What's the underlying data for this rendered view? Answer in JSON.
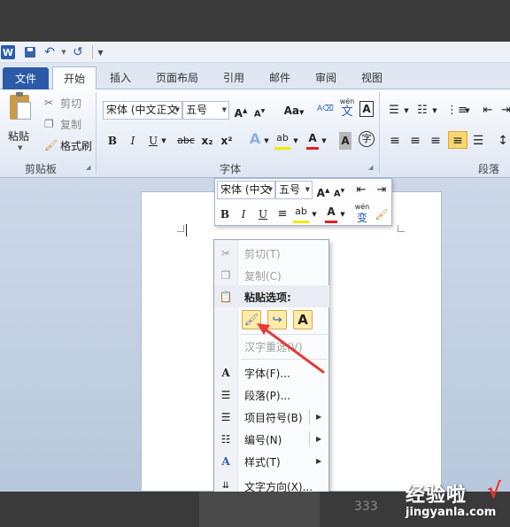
{
  "qat": {
    "logo": "W",
    "undo": "↶",
    "redo": "↺"
  },
  "tabs": [
    "文件",
    "开始",
    "插入",
    "页面布局",
    "引用",
    "邮件",
    "审阅",
    "视图"
  ],
  "clipboard": {
    "paste": "粘贴",
    "cut": "剪切",
    "copy": "复制",
    "format_painter": "格式刷",
    "group": "剪贴板"
  },
  "font": {
    "font_name": "宋体 (中文正文",
    "font_size": "五号",
    "change_case": "Aa",
    "pinyin": "wén",
    "pinyin_char": "文",
    "border_char": "A",
    "group": "字体",
    "format_buttons": [
      "B",
      "I",
      "U",
      "abc",
      "x₂",
      "x²"
    ],
    "text_effects": "A",
    "highlight": "ab",
    "font_color": "A",
    "char_shading": "A",
    "enclose": "字"
  },
  "paragraph": {
    "group": "段落"
  },
  "mini_toolbar": {
    "font_name": "宋体 (中文",
    "font_size": "五号",
    "pinyin": "wén",
    "pinyin_char": "变"
  },
  "context_menu": {
    "cut": "剪切(T)",
    "copy": "复制(C)",
    "paste_options": "粘贴选项:",
    "keep_text_only": "A",
    "hanzi_reconvert": "汉字重选(V)",
    "font": "字体(F)...",
    "paragraph": "段落(P)...",
    "bullets": "项目符号(B)",
    "numbering": "编号(N)",
    "styles": "样式(T)",
    "text_direction": "文字方向(X)..."
  },
  "watermark": {
    "site_cn": "经验啦",
    "check": "√",
    "site_url": "jingyanla.com",
    "partial_number": "333"
  },
  "colors": {
    "file_tab": "#2d5aa8",
    "font_red": "#e02020",
    "highlight_yellow": "#f5e800",
    "arrow_red": "#e33a3a"
  }
}
